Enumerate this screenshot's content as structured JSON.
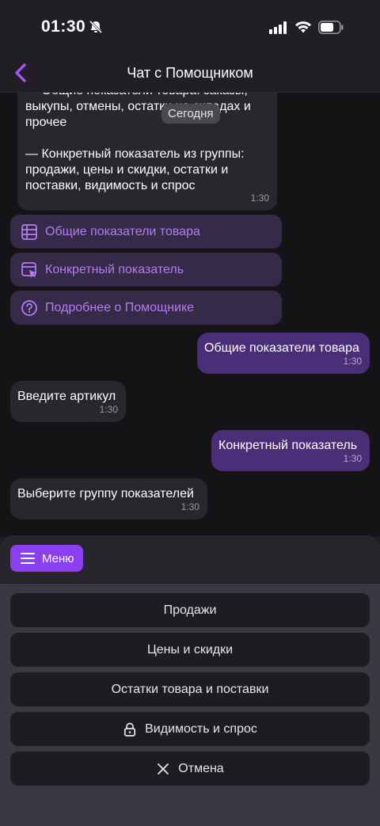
{
  "status": {
    "time": "01:30"
  },
  "header": {
    "title": "Чат с Помощником"
  },
  "chat": {
    "date_chip": "Сегодня",
    "first_message": {
      "text": "— Общие показатели товара: заказы, выкупы, отмены, остатки на складах и прочее\n\n— Конкретный показатель из группы: продажи, цены и скидки, остатки и поставки, видимость и спрос",
      "time": "1:30"
    },
    "quick_buttons": [
      {
        "label": "Общие показатели товара",
        "icon": "table-icon"
      },
      {
        "label": "Конкретный показатель",
        "icon": "cursor-window-icon"
      },
      {
        "label": "Подробнее о Помощнике",
        "icon": "question-circle-icon"
      }
    ],
    "messages": [
      {
        "direction": "out",
        "text": "Общие показатели товара",
        "time": "1:30"
      },
      {
        "direction": "in",
        "text": "Введите артикул",
        "time": "1:30"
      },
      {
        "direction": "out",
        "text": "Конкретный показатель",
        "time": "1:30"
      },
      {
        "direction": "in",
        "text": "Выберите группу показателей",
        "time": "1:30"
      }
    ]
  },
  "panel": {
    "menu_label": "Меню",
    "options": [
      {
        "label": "Продажи",
        "icon": ""
      },
      {
        "label": "Цены и скидки",
        "icon": ""
      },
      {
        "label": "Остатки товара и поставки",
        "icon": ""
      },
      {
        "label": "Видимость и спрос",
        "icon": "lock-icon"
      },
      {
        "label": "Отмена",
        "icon": "close-icon"
      }
    ]
  },
  "colors": {
    "accent": "#8a3ff0",
    "accent_text": "#b47cf0",
    "outgoing_bubble": "#4a2f78",
    "incoming_bubble": "#28272c"
  }
}
